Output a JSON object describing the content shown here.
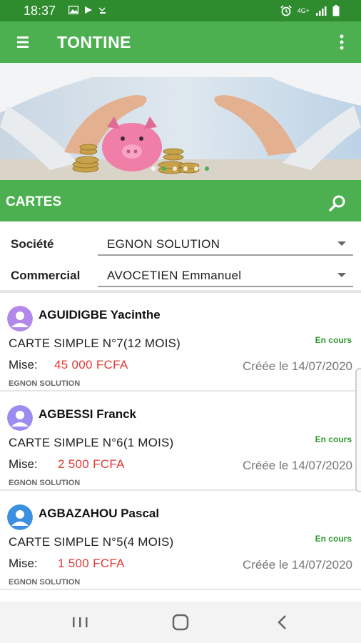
{
  "status_bar": {
    "time": "18:37",
    "network": "4G+"
  },
  "app_bar": {
    "title": "TONTINE"
  },
  "section_bar": {
    "title": "CARTES"
  },
  "filters": {
    "societe": {
      "label": "Société",
      "value": "EGNON SOLUTION"
    },
    "commercial": {
      "label": "Commercial",
      "value": "AVOCETIEN Emmanuel"
    }
  },
  "cards": [
    {
      "name": "AGUIDIGBE Yacinthe",
      "title": "CARTE SIMPLE N°7(12 MOIS)",
      "status": "En cours",
      "mise_label": "Mise:",
      "amount": "45 000 FCFA",
      "created": "Créée le 14/07/2020",
      "company": "EGNON SOLUTION",
      "avatar_color": "#b388eb"
    },
    {
      "name": "AGBESSI Franck",
      "title": "CARTE SIMPLE N°6(1 MOIS)",
      "status": "En cours",
      "mise_label": "Mise:",
      "amount": "2 500 FCFA",
      "created": "Créée le 14/07/2020",
      "company": "EGNON SOLUTION",
      "avatar_color": "#9c8cf0"
    },
    {
      "name": "AGBAZAHOU Pascal",
      "title": "CARTE SIMPLE N°5(4 MOIS)",
      "status": "En cours",
      "mise_label": "Mise:",
      "amount": "1 500 FCFA",
      "created": "Créée le 14/07/2020",
      "company": "EGNON SOLUTION",
      "avatar_color": "#3d8fe0"
    }
  ],
  "colors": {
    "primary": "#4caf50",
    "status_bar": "#2e8b2e",
    "amount": "#e53935",
    "status_text": "#2e9a2e"
  }
}
